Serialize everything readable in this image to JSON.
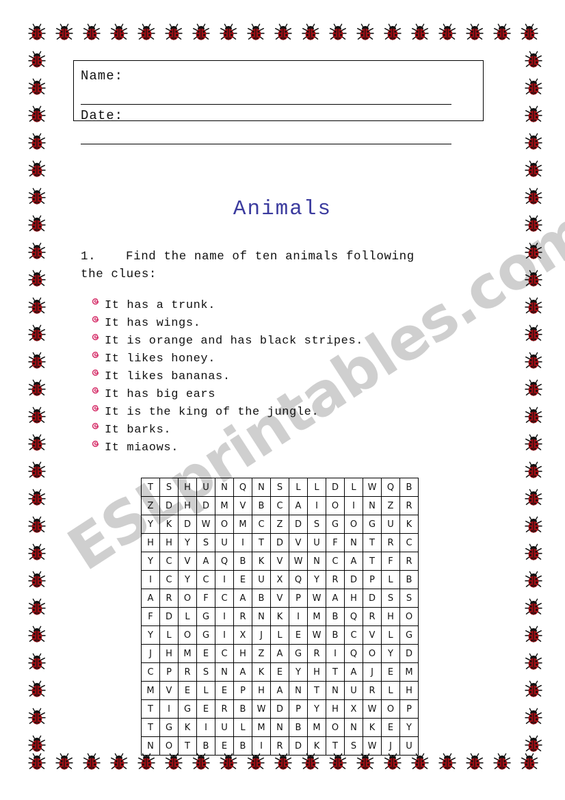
{
  "header": {
    "name_label": "Name:",
    "date_label": "Date:"
  },
  "title": "Animals",
  "instruction": {
    "number": "1.",
    "text": "Find the name of ten animals following the clues:"
  },
  "clues": [
    "It has a trunk.",
    "It has wings.",
    "It is orange and has black stripes.",
    "It likes honey.",
    "It likes bananas.",
    "It has big ears",
    "It is the king of the jungle.",
    "It barks.",
    "It miaows."
  ],
  "wordsearch": {
    "rows": 15,
    "cols": 15,
    "grid": [
      [
        "T",
        "S",
        "H",
        "U",
        "N",
        "Q",
        "N",
        "S",
        "L",
        "L",
        "D",
        "L",
        "W",
        "Q",
        "B"
      ],
      [
        "Z",
        "D",
        "H",
        "D",
        "M",
        "V",
        "B",
        "C",
        "A",
        "I",
        "O",
        "I",
        "N",
        "Z",
        "R"
      ],
      [
        "Y",
        "K",
        "D",
        "W",
        "O",
        "M",
        "C",
        "Z",
        "D",
        "S",
        "G",
        "O",
        "G",
        "U",
        "K"
      ],
      [
        "H",
        "H",
        "Y",
        "S",
        "U",
        "I",
        "T",
        "D",
        "V",
        "U",
        "F",
        "N",
        "T",
        "R",
        "C"
      ],
      [
        "Y",
        "C",
        "V",
        "A",
        "Q",
        "B",
        "K",
        "V",
        "W",
        "N",
        "C",
        "A",
        "T",
        "F",
        "R"
      ],
      [
        "I",
        "C",
        "Y",
        "C",
        "I",
        "E",
        "U",
        "X",
        "Q",
        "Y",
        "R",
        "D",
        "P",
        "L",
        "B"
      ],
      [
        "A",
        "R",
        "O",
        "F",
        "C",
        "A",
        "B",
        "V",
        "P",
        "W",
        "A",
        "H",
        "D",
        "S",
        "S"
      ],
      [
        "F",
        "D",
        "L",
        "G",
        "I",
        "R",
        "N",
        "K",
        "I",
        "M",
        "B",
        "Q",
        "R",
        "H",
        "O"
      ],
      [
        "Y",
        "L",
        "O",
        "G",
        "I",
        "X",
        "J",
        "L",
        "E",
        "W",
        "B",
        "C",
        "V",
        "L",
        "G"
      ],
      [
        "J",
        "H",
        "M",
        "E",
        "C",
        "H",
        "Z",
        "A",
        "G",
        "R",
        "I",
        "Q",
        "O",
        "Y",
        "D"
      ],
      [
        "C",
        "P",
        "R",
        "S",
        "N",
        "A",
        "K",
        "E",
        "Y",
        "H",
        "T",
        "A",
        "J",
        "E",
        "M"
      ],
      [
        "M",
        "V",
        "E",
        "L",
        "E",
        "P",
        "H",
        "A",
        "N",
        "T",
        "N",
        "U",
        "R",
        "L",
        "H"
      ],
      [
        "T",
        "I",
        "G",
        "E",
        "R",
        "B",
        "W",
        "D",
        "P",
        "Y",
        "H",
        "X",
        "W",
        "O",
        "P"
      ],
      [
        "T",
        "G",
        "K",
        "I",
        "U",
        "L",
        "M",
        "N",
        "B",
        "M",
        "O",
        "N",
        "K",
        "E",
        "Y"
      ],
      [
        "N",
        "O",
        "T",
        "B",
        "E",
        "B",
        "I",
        "R",
        "D",
        "K",
        "T",
        "S",
        "W",
        "J",
        "U"
      ]
    ]
  },
  "watermark": "ESLprintables.com",
  "colors": {
    "title": "#3b3b9e",
    "bullet": "#d6336c",
    "ladybug_body": "#a50f15",
    "ladybug_dark": "#111111",
    "watermark": "#c9c9c9"
  },
  "icons": {
    "bullet": "spiral-bullet-icon",
    "border": "ladybug-icon"
  }
}
